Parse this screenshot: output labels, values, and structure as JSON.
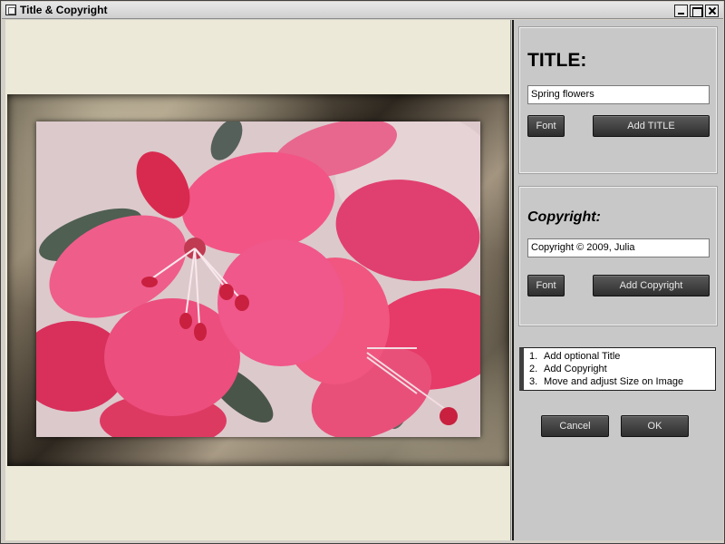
{
  "window": {
    "title": "Title & Copyright"
  },
  "title_group": {
    "heading": "TITLE:",
    "input_value": "Spring flowers",
    "font_button": "Font",
    "add_button": "Add TITLE"
  },
  "copyright_group": {
    "heading": "Copyright:",
    "input_value": "Copyright © 2009, Julia",
    "font_button": "Font",
    "add_button": "Add Copyright"
  },
  "instructions": [
    {
      "num": "1.",
      "text": "Add optional Title"
    },
    {
      "num": "2.",
      "text": "Add Copyright"
    },
    {
      "num": "3.",
      "text": "Move and adjust Size on Image"
    }
  ],
  "dialog": {
    "cancel": "Cancel",
    "ok": "OK"
  },
  "image": {
    "subject": "pink-flowers-photo",
    "frame": "gold-marble-frame"
  }
}
